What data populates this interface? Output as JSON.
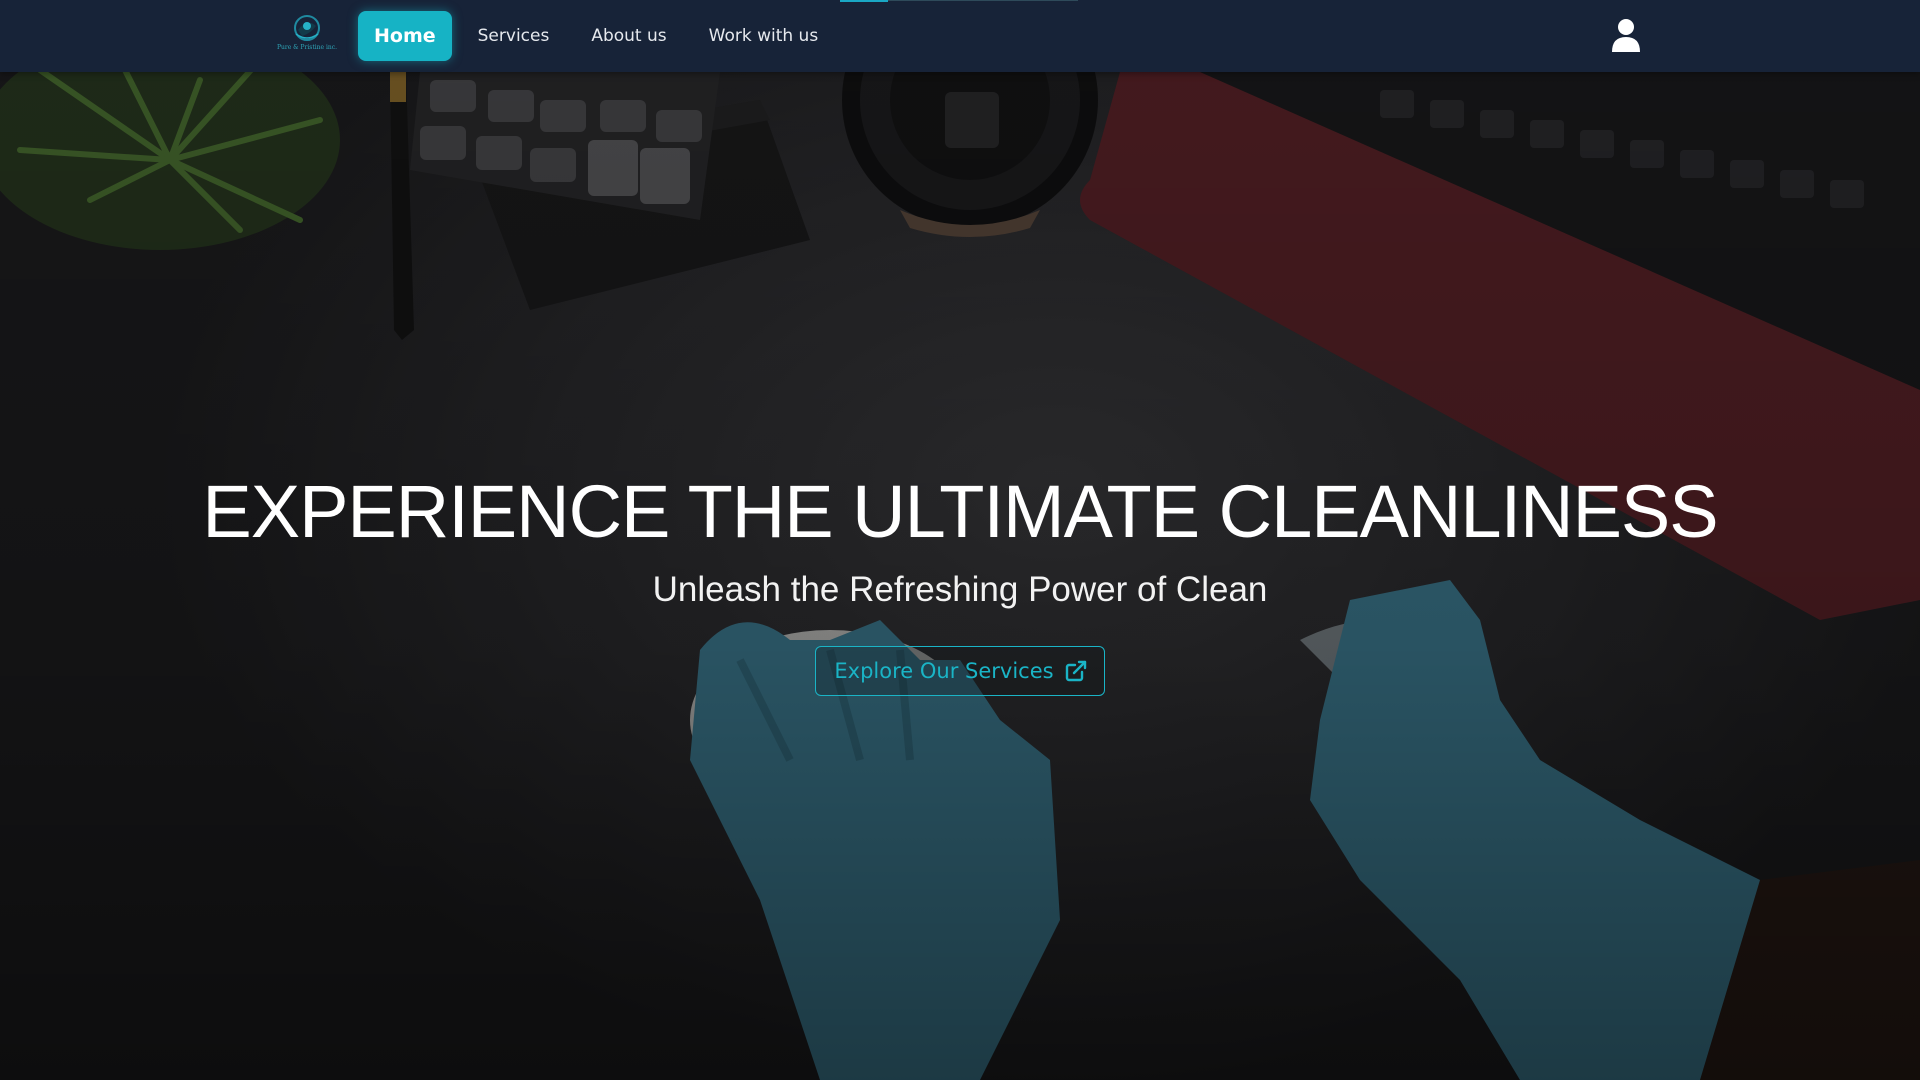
{
  "brand": {
    "caption": "Pure & Pristine inc."
  },
  "nav": {
    "items": [
      {
        "label": "Home",
        "active": true
      },
      {
        "label": "Services"
      },
      {
        "label": "About us"
      },
      {
        "label": "Work with us"
      }
    ],
    "user_icon": "user-icon"
  },
  "hero": {
    "title": "EXPERIENCE THE ULTIMATE CLEANLINESS",
    "subtitle": "Unleash the Refreshing Power of Clean",
    "cta_label": "Explore Our Services",
    "cta_icon": "external-link-icon"
  },
  "colors": {
    "navbar_bg": "#172338",
    "accent": "#16b3c5",
    "text_light": "#ffffff"
  }
}
